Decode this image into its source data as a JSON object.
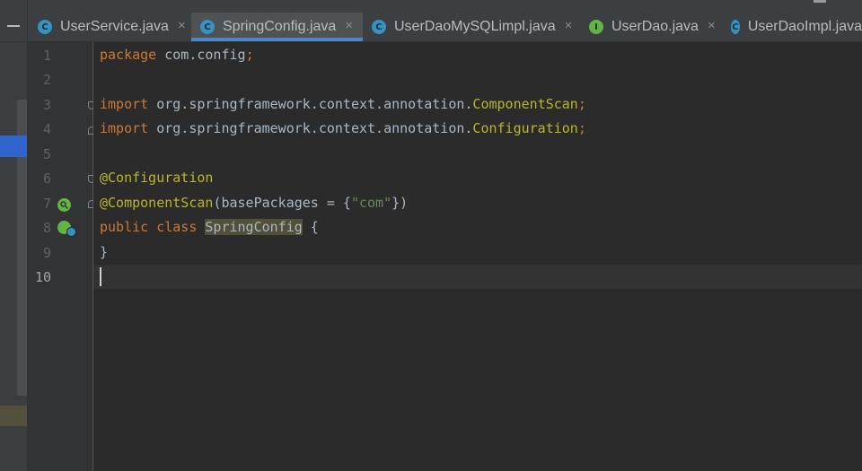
{
  "tabs": [
    {
      "label": "UserService.java",
      "icon": "class-icon",
      "icon_letter": "C",
      "close": "×",
      "active": false
    },
    {
      "label": "SpringConfig.java",
      "icon": "class-icon",
      "icon_letter": "C",
      "close": "×",
      "active": true
    },
    {
      "label": "UserDaoMySQLimpl.java",
      "icon": "class-icon",
      "icon_letter": "C",
      "close": "×",
      "active": false
    },
    {
      "label": "UserDao.java",
      "icon": "interface-icon",
      "icon_letter": "I",
      "close": "×",
      "active": false
    },
    {
      "label": "UserDaoImpl.java",
      "icon": "class-icon",
      "icon_letter": "C",
      "close": "",
      "active": false
    }
  ],
  "line_numbers": [
    "1",
    "2",
    "3",
    "4",
    "5",
    "6",
    "7",
    "8",
    "9",
    "10"
  ],
  "current_line": "10",
  "code": {
    "l1_kw": "package",
    "l1_rest": " com.config",
    "l1_semi": ";",
    "l3_kw": "import",
    "l3_pkg": " org.springframework.context.annotation.",
    "l3_cls": "ComponentScan",
    "l3_semi": ";",
    "l4_kw": "import",
    "l4_pkg": " org.springframework.context.annotation.",
    "l4_cls": "Configuration",
    "l4_semi": ";",
    "l6_ann": "@Configuration",
    "l7_ann": "@ComponentScan",
    "l7_mid": "(basePackages = {",
    "l7_str": "\"com\"",
    "l7_end": "})",
    "l8_kw1": "public",
    "l8_kw2": "class",
    "l8_name": "SpringConfig",
    "l8_end": " {",
    "l9": "}"
  },
  "colors": {
    "keyword": "#cc7832",
    "annotation": "#bbb529",
    "string": "#6a8759",
    "text": "#a9b7c6",
    "tab_accent": "#4a88c7",
    "class_icon": "#3592c4",
    "interface_icon": "#62b543"
  }
}
